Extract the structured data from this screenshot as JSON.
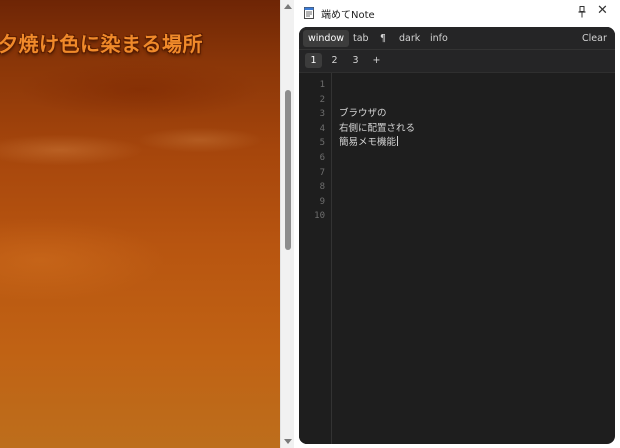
{
  "web": {
    "headline": "夕焼け色に染まる場所"
  },
  "panel": {
    "title": "端めてNote",
    "icons": {
      "app": "notepad-icon",
      "pin": "pin-icon",
      "close": "close-icon"
    },
    "close_glyph": "✕"
  },
  "toolbar": {
    "window": "window",
    "tab": "tab",
    "pilcrow": "¶",
    "dark": "dark",
    "info": "info",
    "clear": "Clear",
    "active": "window"
  },
  "tabs": [
    "1",
    "2",
    "3",
    "+"
  ],
  "active_tab": "1",
  "editor": {
    "line_numbers": [
      "1",
      "2",
      "3",
      "4",
      "5",
      "6",
      "7",
      "8",
      "9",
      "10"
    ],
    "lines": [
      "",
      "",
      "ブラウザの",
      "右側に配置される",
      "簡易メモ機能",
      "",
      "",
      "",
      "",
      ""
    ]
  },
  "colors": {
    "sunset_top": "#6e2505",
    "sunset_bottom": "#bd6e1c",
    "headline": "#f08a2a",
    "editor_bg": "#1e1e1e",
    "toolbar_bg": "#252526",
    "text": "#d4d4d4"
  }
}
